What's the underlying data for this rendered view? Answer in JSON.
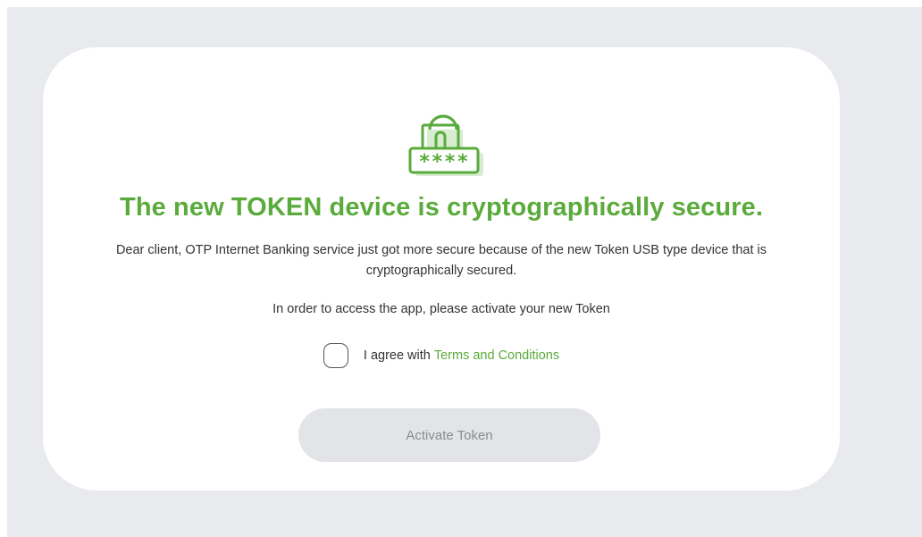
{
  "colors": {
    "accent": "#5aab3c",
    "accent_light": "#d7ecd0",
    "backdrop": "#e9eaee",
    "button_disabled": "#e3e4e8",
    "button_disabled_text": "#8a8b8f"
  },
  "icon": {
    "name": "lock-password-icon",
    "mask": "****"
  },
  "headline": "The new TOKEN device is cryptographically secure.",
  "intro": "Dear client, OTP Internet Banking service just got more secure because of the new Token USB type device that is cryptographically secured.",
  "instruction": "In order to access the app, please activate your new Token",
  "agreement": {
    "checked": false,
    "label": "I agree with",
    "link_text": "Terms and Conditions"
  },
  "activate_button": {
    "label": "Activate Token",
    "disabled": true
  }
}
